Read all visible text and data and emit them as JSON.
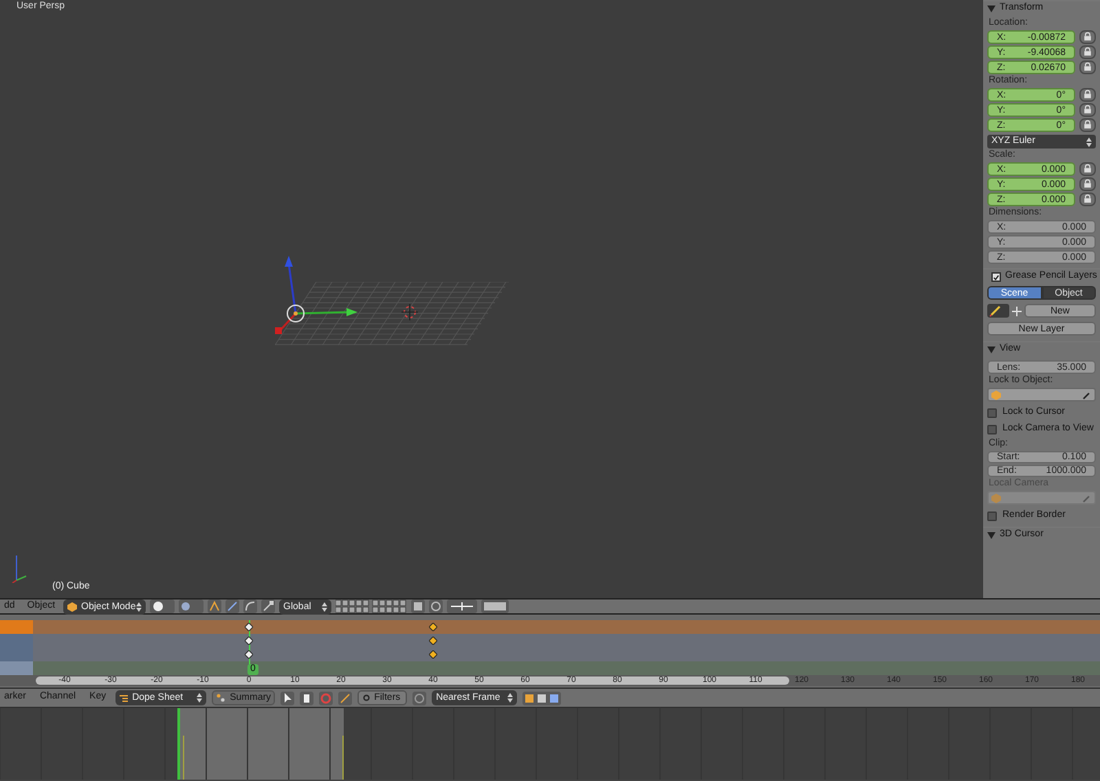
{
  "viewport": {
    "title": "User Persp",
    "object_label": "(0) Cube"
  },
  "properties": {
    "transform": {
      "title": "Transform",
      "groups": [
        {
          "label": "Location:",
          "keyed": true,
          "lockable": true,
          "fields": [
            {
              "axis": "X:",
              "value": "-0.00872"
            },
            {
              "axis": "Y:",
              "value": "-9.40068"
            },
            {
              "axis": "Z:",
              "value": "0.02670"
            }
          ]
        },
        {
          "label": "Rotation:",
          "keyed": true,
          "lockable": true,
          "fields": [
            {
              "axis": "X:",
              "value": "0°"
            },
            {
              "axis": "Y:",
              "value": "0°"
            },
            {
              "axis": "Z:",
              "value": "0°"
            }
          ],
          "mode": "XYZ Euler"
        },
        {
          "label": "Scale:",
          "keyed": true,
          "lockable": true,
          "fields": [
            {
              "axis": "X:",
              "value": "0.000"
            },
            {
              "axis": "Y:",
              "value": "0.000"
            },
            {
              "axis": "Z:",
              "value": "0.000"
            }
          ]
        },
        {
          "label": "Dimensions:",
          "keyed": false,
          "lockable": false,
          "fields": [
            {
              "axis": "X:",
              "value": "0.000"
            },
            {
              "axis": "Y:",
              "value": "0.000"
            },
            {
              "axis": "Z:",
              "value": "0.000"
            }
          ]
        }
      ]
    },
    "grease_pencil": {
      "title": "Grease Pencil Layers",
      "checked": true,
      "tabs": [
        {
          "label": "Scene",
          "selected": true
        },
        {
          "label": "Object",
          "selected": false
        }
      ],
      "new_button": "New",
      "new_layer_button": "New Layer"
    },
    "view": {
      "title": "View",
      "lens": {
        "label": "Lens:",
        "value": "35.000"
      },
      "lock_to_object": "Lock to Object:",
      "checks": [
        {
          "label": "Lock to Cursor",
          "checked": false
        },
        {
          "label": "Lock Camera to View",
          "checked": false
        }
      ],
      "clip": "Clip:",
      "clip_fields": [
        {
          "label": "Start:",
          "value": "0.100"
        },
        {
          "label": "End:",
          "value": "1000.000"
        }
      ],
      "local_camera": {
        "label": "Local Camera",
        "disabled": true
      },
      "render_border": {
        "label": "Render Border",
        "checked": false
      }
    },
    "cursor_panel": {
      "title": "3D Cursor"
    }
  },
  "view3d_header": {
    "menus": [
      "dd",
      "Object"
    ],
    "mode": "Object Mode",
    "orientation": "Global"
  },
  "dopesheet": {
    "rows": [
      {
        "kind": "summary"
      },
      {
        "kind": "object"
      },
      {
        "kind": "object"
      },
      {
        "kind": "action"
      }
    ],
    "current_frame": "0",
    "ruler": [
      {
        "label": "-40",
        "kind": "none"
      },
      {
        "label": "-30",
        "kind": "none"
      },
      {
        "label": "-20",
        "kind": "none"
      },
      {
        "label": "-10",
        "kind": "none"
      },
      {
        "label": "0",
        "kind": "key"
      },
      {
        "label": "10",
        "kind": "none"
      },
      {
        "label": "20",
        "kind": "none"
      },
      {
        "label": "30",
        "kind": "none"
      },
      {
        "label": "40",
        "kind": "selected_key"
      },
      {
        "label": "50",
        "kind": "none"
      },
      {
        "label": "60",
        "kind": "none"
      },
      {
        "label": "70",
        "kind": "none"
      },
      {
        "label": "80",
        "kind": "none"
      },
      {
        "label": "90",
        "kind": "none"
      },
      {
        "label": "100",
        "kind": "none"
      },
      {
        "label": "110",
        "kind": "none"
      },
      {
        "label": "120",
        "kind": "none"
      },
      {
        "label": "130",
        "kind": "none"
      },
      {
        "label": "140",
        "kind": "none"
      },
      {
        "label": "150",
        "kind": "none"
      },
      {
        "label": "160",
        "kind": "none"
      },
      {
        "label": "170",
        "kind": "none"
      },
      {
        "label": "180",
        "kind": "none"
      }
    ]
  },
  "dopesheet_header": {
    "menus": [
      "arker",
      "Channel",
      "Key"
    ],
    "editor": "Dope Sheet",
    "mode": "Summary",
    "filters": "Filters",
    "snap": "Nearest Frame"
  }
}
